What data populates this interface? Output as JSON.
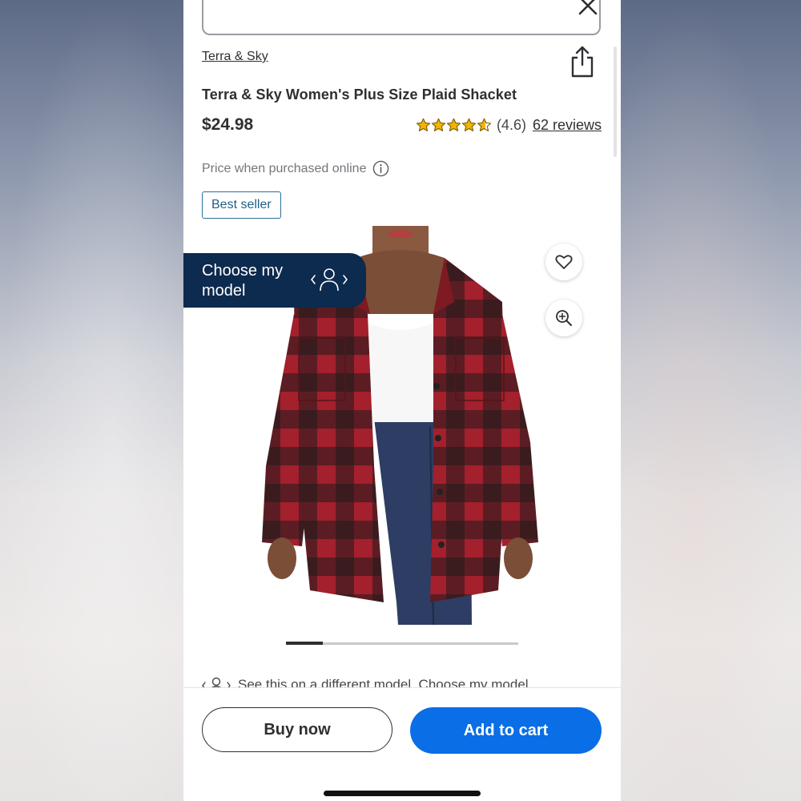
{
  "product": {
    "brand": "Terra & Sky",
    "title": "Terra & Sky Women's Plus Size Plaid Shacket",
    "price": "$24.98",
    "rating_value": 4.6,
    "rating_text": "(4.6)",
    "reviews_text": "62 reviews",
    "price_note": "Price when purchased online",
    "badge": "Best seller"
  },
  "image_panel": {
    "choose_model_label": "Choose my model",
    "carousel_position": 0.16,
    "model_hint": "See this on a different model. Choose my model"
  },
  "actions": {
    "buy_now": "Buy now",
    "add_to_cart": "Add to cart"
  },
  "icons": {
    "close": "close-icon",
    "share": "share-icon",
    "info": "info-icon",
    "favorite": "heart-icon",
    "zoom": "zoom-in-icon",
    "model": "person-switch-icon"
  },
  "colors": {
    "accent_blue": "#0a6ee6",
    "navy": "#0d2a4f",
    "star_gold": "#f3b400",
    "badge_blue": "#1f5f86",
    "plaid_red": "#a3202c",
    "plaid_black": "#1f1b1c"
  }
}
